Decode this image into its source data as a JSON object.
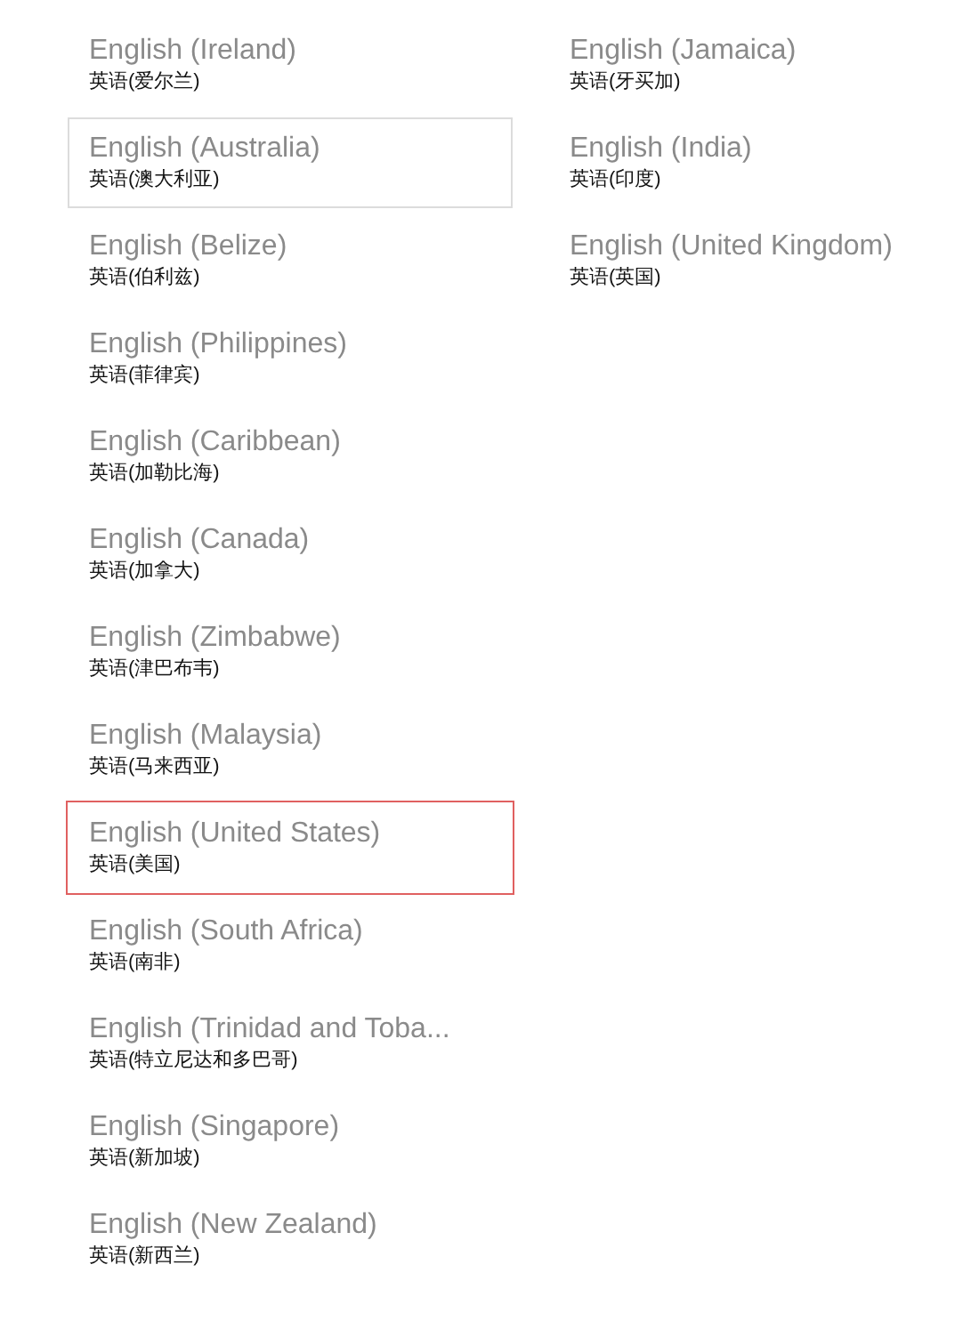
{
  "columns": [
    {
      "items": [
        {
          "name": "English (Ireland)",
          "native": "英语(爱尔兰)",
          "focused": false,
          "highlighted": false
        },
        {
          "name": "English (Australia)",
          "native": "英语(澳大利亚)",
          "focused": true,
          "highlighted": false
        },
        {
          "name": "English (Belize)",
          "native": "英语(伯利兹)",
          "focused": false,
          "highlighted": false
        },
        {
          "name": "English (Philippines)",
          "native": "英语(菲律宾)",
          "focused": false,
          "highlighted": false
        },
        {
          "name": "English (Caribbean)",
          "native": "英语(加勒比海)",
          "focused": false,
          "highlighted": false
        },
        {
          "name": "English (Canada)",
          "native": "英语(加拿大)",
          "focused": false,
          "highlighted": false
        },
        {
          "name": "English (Zimbabwe)",
          "native": "英语(津巴布韦)",
          "focused": false,
          "highlighted": false
        },
        {
          "name": "English (Malaysia)",
          "native": "英语(马来西亚)",
          "focused": false,
          "highlighted": false
        },
        {
          "name": "English (United States)",
          "native": "英语(美国)",
          "focused": false,
          "highlighted": true
        },
        {
          "name": "English (South Africa)",
          "native": "英语(南非)",
          "focused": false,
          "highlighted": false
        },
        {
          "name": "English (Trinidad and Toba...",
          "native": "英语(特立尼达和多巴哥)",
          "focused": false,
          "highlighted": false
        },
        {
          "name": "English (Singapore)",
          "native": "英语(新加坡)",
          "focused": false,
          "highlighted": false
        },
        {
          "name": "English (New Zealand)",
          "native": "英语(新西兰)",
          "focused": false,
          "highlighted": false
        }
      ]
    },
    {
      "items": [
        {
          "name": "English (Jamaica)",
          "native": "英语(牙买加)",
          "focused": false,
          "highlighted": false
        },
        {
          "name": "English (India)",
          "native": "英语(印度)",
          "focused": false,
          "highlighted": false
        },
        {
          "name": "English (United Kingdom)",
          "native": "英语(英国)",
          "focused": false,
          "highlighted": false
        }
      ]
    }
  ]
}
